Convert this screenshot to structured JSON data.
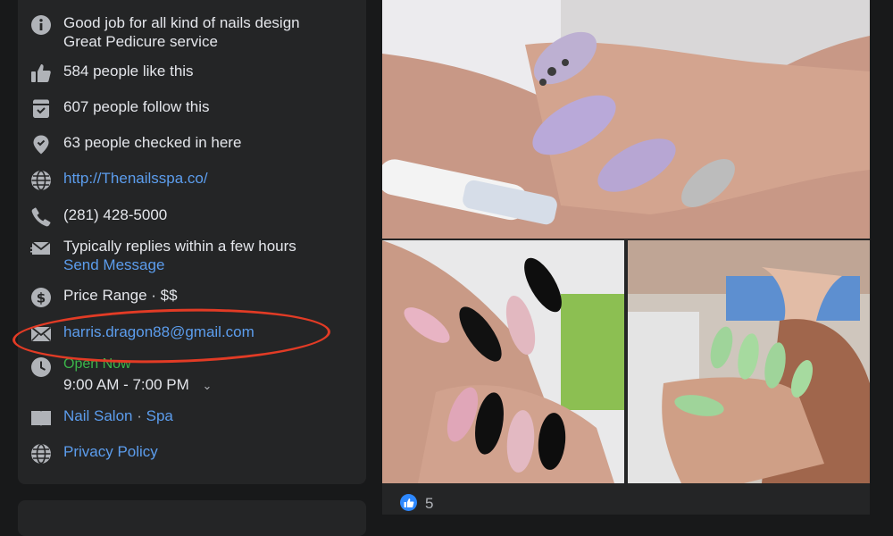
{
  "about": {
    "intro": {
      "icon": "info-icon",
      "text": "Good job for all kind of nails design Great Pedicure service"
    },
    "likes": {
      "icon": "thumbs-up-icon",
      "text": "584 people like this"
    },
    "follows": {
      "icon": "follow-icon",
      "text": "607 people follow this"
    },
    "checkins": {
      "icon": "check-in-icon",
      "text": "63 people checked in here"
    },
    "website": {
      "icon": "globe-icon",
      "text": "http://Thenailsspa.co/"
    },
    "phone": {
      "icon": "phone-icon",
      "text": "(281) 428-5000"
    },
    "replies": {
      "icon": "message-icon",
      "text": "Typically replies within a few hours",
      "action": "Send Message"
    },
    "price": {
      "icon": "price-icon",
      "text": "Price Range · $$"
    },
    "email": {
      "icon": "email-icon",
      "text": "harris.dragon88@gmail.com"
    },
    "hours": {
      "icon": "clock-icon",
      "status": "Open Now",
      "time": "9:00 AM - 7:00 PM"
    },
    "category": {
      "icon": "category-icon",
      "first": "Nail Salon",
      "sep": " · ",
      "second": "Spa"
    },
    "privacy": {
      "icon": "globe-icon",
      "text": "Privacy Policy"
    }
  },
  "photos": [
    {
      "name": "photo-lavender-nails"
    },
    {
      "name": "photo-black-pink-nails"
    },
    {
      "name": "photo-green-glitter-nails"
    }
  ],
  "reactions": {
    "icon": "like-reaction-icon",
    "count": "5"
  },
  "annotation": {
    "color": "#e23b25"
  },
  "colors": {
    "link": "#5c9ded",
    "open": "#3bb54a",
    "card": "#242526",
    "background": "#18191a"
  }
}
